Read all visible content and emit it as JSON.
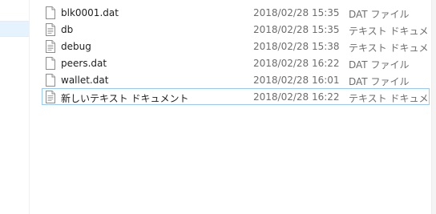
{
  "files": [
    {
      "name": "blk0001.dat",
      "modified": "2018/02/28 15:35",
      "type": "DAT ファイル"
    },
    {
      "name": "db",
      "modified": "2018/02/28 15:35",
      "type": "テキスト ドキュメント"
    },
    {
      "name": "debug",
      "modified": "2018/02/28 15:38",
      "type": "テキスト ドキュメント"
    },
    {
      "name": "peers.dat",
      "modified": "2018/02/28 16:22",
      "type": "DAT ファイル"
    },
    {
      "name": "wallet.dat",
      "modified": "2018/02/28 16:01",
      "type": "DAT ファイル"
    },
    {
      "name": "新しいテキスト ドキュメント",
      "modified": "2018/02/28 16:22",
      "type": "テキスト ドキュメント"
    }
  ],
  "icons": {
    "dat": "file-icon",
    "text": "text-document-icon"
  },
  "colors": {
    "selection_border": "#99c9ef",
    "nav_selection": "#e5f3ff",
    "secondary_text": "#6d6d6d"
  }
}
